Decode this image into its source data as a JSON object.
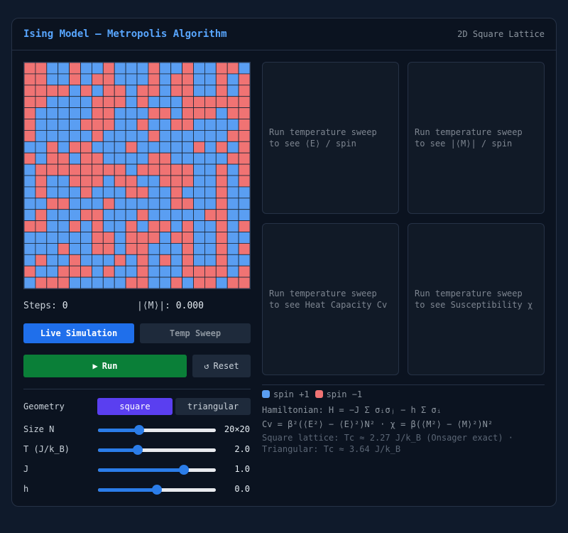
{
  "header": {
    "title": "Ising Model — Metropolis Algorithm",
    "subtitle": "2D Square Lattice"
  },
  "lattice": {
    "size": 20,
    "colors": {
      "up": "#5a9ef2",
      "down": "#f07373",
      "line": "#1a2433"
    },
    "spins": [
      "DDUUDUUDUUUDUUDUUDDU",
      "DDUUDUDDUUUDUDDUUDUD",
      "DDDDUDUDDUDDUDDUUDUD",
      "DDUUUUDDDUDUUUDDDDDD",
      "DUUUUUDDUUUDDUDDDUDD",
      "DUUUUDDDUUDUUDDUUUUD",
      "DUUUUUDUUUUDUUUUUUDD",
      "UUDUDDUUUDUUUUUDUDUD",
      "DUDDUDDUUUUDDUUUUUDD",
      "UDDDDDDDDUDDDDDUUDUD",
      "UDUUDDDUDDUUDDDUUDUD",
      "UDUUUDUUUDDUUDUUUDUU",
      "UUDDUUUDUUUUUDDUUDUU",
      "UDUUUDDUUUDUUUUUDDUU",
      "DDUUDUDUUDUDDUDUUDUD",
      "UUUUUUDDUDDDUDDUUDUU",
      "UUUDUUDDUDDUUUDUUDUD",
      "UDUUDUUUDUDUDUDUUDUU",
      "DUUDDDUDUUDUUUDDDDUD",
      "UDDDUUUUUDDUUDUDDUDD"
    ]
  },
  "stats": {
    "steps_label": "Steps:",
    "steps_value": "0",
    "mag_label": "|⟨M⟩|:",
    "mag_value": "0.000"
  },
  "modes": {
    "live": "Live Simulation",
    "sweep": "Temp Sweep"
  },
  "actions": {
    "run": "Run",
    "run_icon": "▶",
    "reset": "Reset",
    "reset_icon": "↺"
  },
  "controls": {
    "geometry_label": "Geometry",
    "geometry_options": [
      "square",
      "triangular"
    ],
    "sliders": [
      {
        "label": "Size N",
        "value": "20×20",
        "fraction": 0.35
      },
      {
        "label": "T (J/k_B)",
        "value": "2.0",
        "fraction": 0.34
      },
      {
        "label": "J",
        "value": "1.0",
        "fraction": 0.73
      },
      {
        "label": "h",
        "value": "0.0",
        "fraction": 0.5
      }
    ]
  },
  "panels": [
    {
      "text": "Run temperature sweep to see ⟨E⟩ / spin"
    },
    {
      "text": "Run temperature sweep to see |⟨M⟩| / spin"
    },
    {
      "text": "Run temperature sweep to see Heat Capacity Cv"
    },
    {
      "text": "Run temperature sweep to see Susceptibility χ"
    }
  ],
  "legend": {
    "up_label": "spin +1",
    "down_label": "spin −1",
    "up_color": "#5a9ef2",
    "down_color": "#f07373"
  },
  "formulas": {
    "hamiltonian": "Hamiltonian: H = −J Σ σᵢσⱼ − h Σ σᵢ",
    "observables": "Cv = β²(⟨E²⟩ − ⟨E⟩²)N²  ·  χ = β(⟨M²⟩ − ⟨M⟩²)N²",
    "critical_note": "Square lattice: Tc ≈ 2.27 J/k_B (Onsager exact)  ·  Triangular: Tc ≈ 3.64 J/k_B"
  }
}
